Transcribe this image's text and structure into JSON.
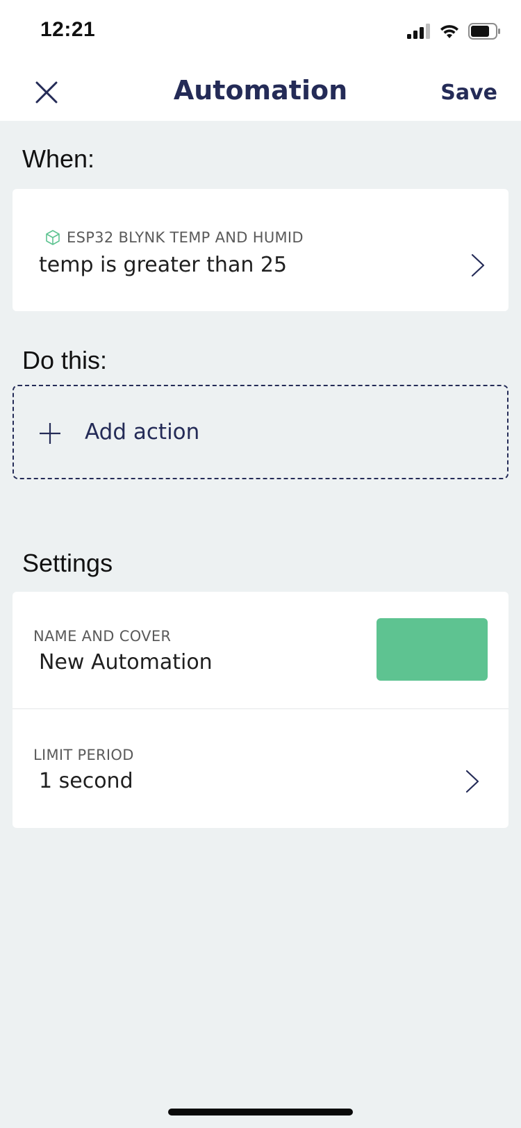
{
  "status_bar": {
    "time": "12:21",
    "icons": [
      "cellular-signal-icon",
      "wifi-icon",
      "battery-icon"
    ]
  },
  "header": {
    "close_icon": "close-icon",
    "title": "Automation",
    "save_label": "Save"
  },
  "when": {
    "section_title": "When:",
    "trigger": {
      "device_icon": "device-cube-icon",
      "device_name": "ESP32 BLYNK TEMP AND HUMID",
      "condition": "temp is greater than 25"
    }
  },
  "do_this": {
    "section_title": "Do this:",
    "add_action_label": "Add action"
  },
  "settings": {
    "section_title": "Settings",
    "name_and_cover": {
      "label": "NAME AND COVER",
      "value": "New Automation",
      "cover_color": "#5ec391"
    },
    "limit_period": {
      "label": "LIMIT PERIOD",
      "value": "1 second"
    }
  },
  "colors": {
    "accent": "#242b57",
    "background": "#edf1f2",
    "device_icon": "#5ec391"
  }
}
